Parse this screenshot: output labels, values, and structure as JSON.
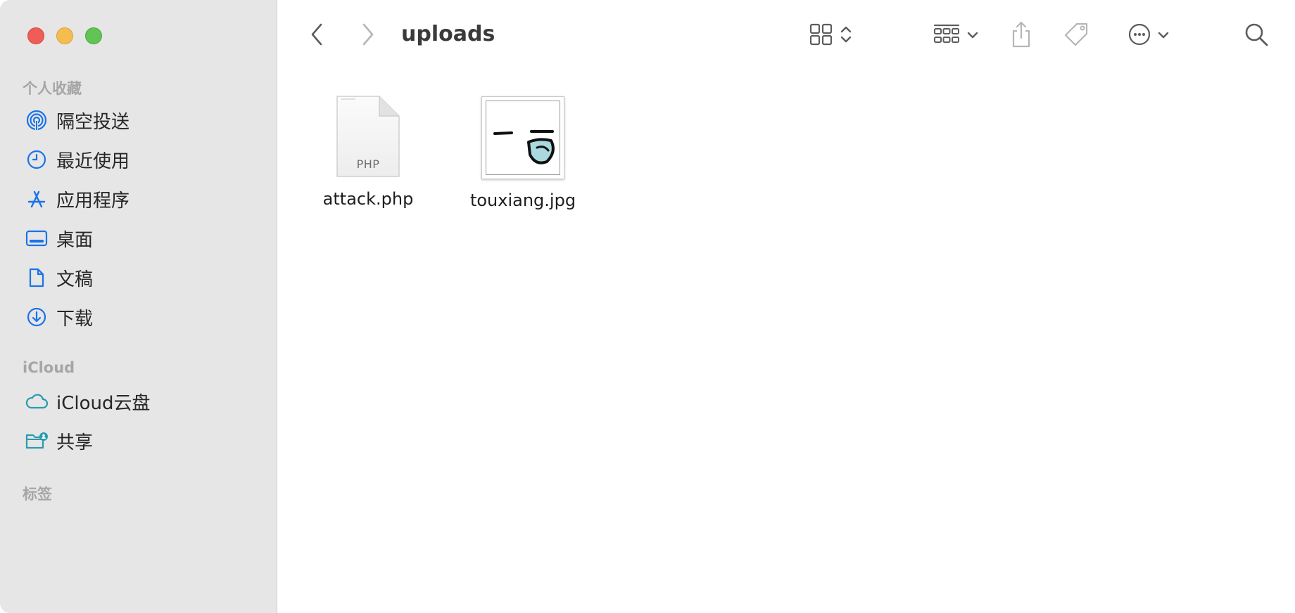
{
  "window": {
    "title": "uploads"
  },
  "sidebar": {
    "sections": [
      {
        "header": "个人收藏",
        "items": [
          {
            "label": "隔空投送",
            "icon": "airdrop-icon"
          },
          {
            "label": "最近使用",
            "icon": "clock-icon"
          },
          {
            "label": "应用程序",
            "icon": "applications-icon"
          },
          {
            "label": "桌面",
            "icon": "desktop-icon"
          },
          {
            "label": "文稿",
            "icon": "document-icon"
          },
          {
            "label": "下载",
            "icon": "download-icon"
          }
        ]
      },
      {
        "header": "iCloud",
        "items": [
          {
            "label": "iCloud云盘",
            "icon": "cloud-icon"
          },
          {
            "label": "共享",
            "icon": "shared-folder-icon"
          }
        ]
      },
      {
        "header": "标签",
        "items": []
      }
    ]
  },
  "toolbar": {
    "back": "chevron-left-icon",
    "forward": "chevron-right-icon",
    "view_mode": "grid-view-icon",
    "group": "group-icon",
    "share": "share-icon",
    "tag": "tag-icon",
    "more": "more-icon",
    "search": "search-icon"
  },
  "files": [
    {
      "name": "attack.php",
      "type_label": "PHP",
      "icon": "php-file-icon"
    },
    {
      "name": "touxiang.jpg",
      "icon": "image-thumbnail"
    }
  ],
  "colors": {
    "accent": "#1a73e8",
    "sidebar_bg": "#e6e6e6",
    "close": "#ee5e57",
    "minimize": "#f5bd4f",
    "maximize": "#61c454",
    "icloud_teal": "#2a9bb0"
  }
}
